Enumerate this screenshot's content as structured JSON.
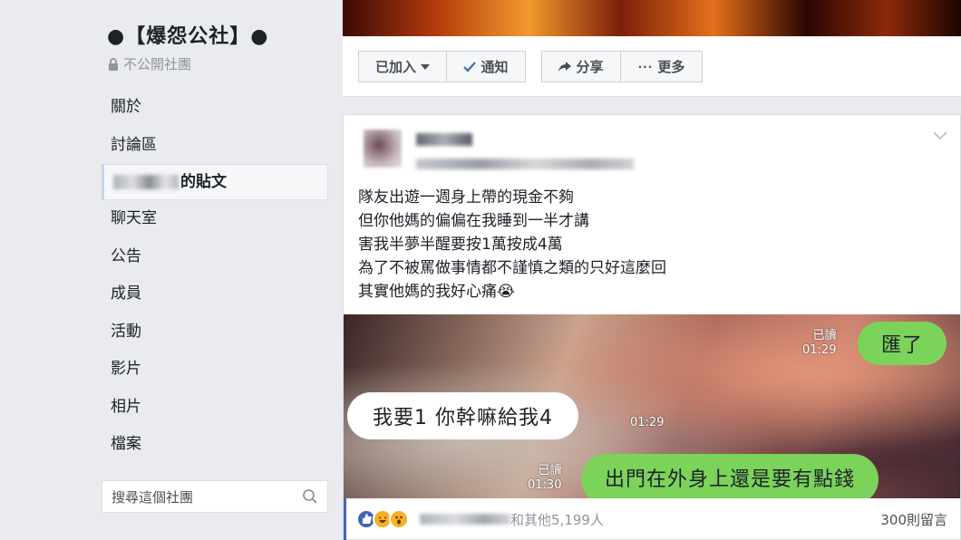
{
  "sidebar": {
    "group_name": "●【爆怨公社】●",
    "privacy": "不公開社團",
    "nav": {
      "about": "關於",
      "discussion": "討論區",
      "member_posts": "的貼文",
      "chat": "聊天室",
      "announcements": "公告",
      "members": "成員",
      "events": "活動",
      "videos": "影片",
      "photos": "相片",
      "files": "檔案"
    },
    "search_placeholder": "搜尋這個社團"
  },
  "action_bar": {
    "joined": "已加入",
    "notifications": "通知",
    "share": "分享",
    "more": "更多"
  },
  "post": {
    "lines": [
      "隊友出遊一週身上帶的現金不夠",
      "但你他媽的偏偏在我睡到一半才講",
      "害我半夢半醒要按1萬按成4萬",
      "為了不被罵做事情都不謹慎之類的只好這麼回",
      "其實他媽的我好心痛😭"
    ],
    "chat": {
      "msg1": "匯了",
      "msg1_read": "已讀",
      "msg1_time": "01:29",
      "msg2": "我要1 你幹嘛給我4",
      "msg2_time": "01:29",
      "msg3": "出門在外身上還是要有點錢",
      "msg3_read": "已讀",
      "msg3_time": "01:30"
    },
    "reactions_text": "和其他5,199人",
    "comments": "300則留言"
  },
  "colors": {
    "background": "#e9ebee",
    "line_green": "#7bd35a",
    "like_blue": "#4267b2"
  }
}
